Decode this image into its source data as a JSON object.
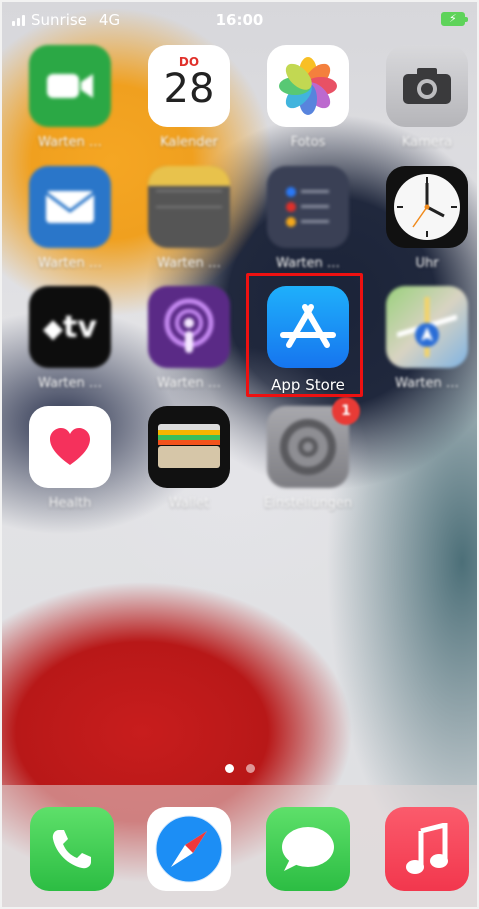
{
  "status_bar": {
    "carrier": "Sunrise",
    "network": "4G",
    "time": "16:00",
    "battery_icon": "battery-charging-icon",
    "battery_color": "#5ed35a"
  },
  "apps": [
    {
      "label": "Warten …",
      "icon": "facetime-icon",
      "color": "#2ba845"
    },
    {
      "label": "Kalender",
      "icon": "calendar-icon",
      "weekday": "DO",
      "day": "28"
    },
    {
      "label": "Fotos",
      "icon": "photos-icon"
    },
    {
      "label": "Kamera",
      "icon": "camera-icon"
    },
    {
      "label": "Warten …",
      "icon": "mail-icon",
      "color": "#2a8bf2"
    },
    {
      "label": "Warten …",
      "icon": "notes-icon"
    },
    {
      "label": "Warten …",
      "icon": "reminders-icon"
    },
    {
      "label": "Uhr",
      "icon": "clock-icon"
    },
    {
      "label": "Warten …",
      "icon": "apple-tv-icon",
      "text": "tv"
    },
    {
      "label": "Warten …",
      "icon": "podcasts-icon",
      "color": "#8e3fd6"
    },
    {
      "label": "App Store",
      "icon": "app-store-icon",
      "color": "#1a8ff5"
    },
    {
      "label": "Warten …",
      "icon": "maps-icon"
    },
    {
      "label": "Health",
      "icon": "health-icon"
    },
    {
      "label": "Wallet",
      "icon": "wallet-icon"
    },
    {
      "label": "Einstellungen",
      "icon": "settings-icon",
      "badge": "1"
    }
  ],
  "page_indicator": {
    "pages": 2,
    "current": 1
  },
  "dock": [
    {
      "icon": "phone-icon",
      "color": "#3ecb4f"
    },
    {
      "icon": "safari-icon",
      "color": "#1c8ef5"
    },
    {
      "icon": "messages-icon",
      "color": "#3ecb4f"
    },
    {
      "icon": "music-icon",
      "color": "#f7374f"
    }
  ],
  "highlight_color": "#e11111"
}
